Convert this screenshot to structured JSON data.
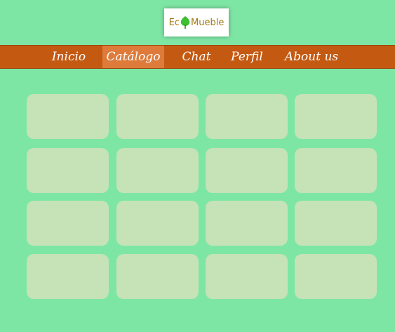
{
  "brand": {
    "logo_prefix": "Ec",
    "logo_suffix": "Mueble",
    "logo_color": "#a07a12",
    "leaf_icon": "leaf-icon",
    "leaf_color": "#3dbf2f"
  },
  "nav": {
    "items": [
      {
        "label": "Inicio",
        "active": false
      },
      {
        "label": "Catálogo",
        "active": true
      },
      {
        "label": "Chat",
        "active": false
      },
      {
        "label": "Perfil",
        "active": false
      },
      {
        "label": "About us",
        "active": false
      }
    ],
    "bar_color": "#c45a12",
    "active_color": "#de7b3b"
  },
  "catalog": {
    "card_count": 16,
    "columns": 4,
    "card_color": "#c6e2b7"
  },
  "colors": {
    "background": "#7ee6a4"
  }
}
